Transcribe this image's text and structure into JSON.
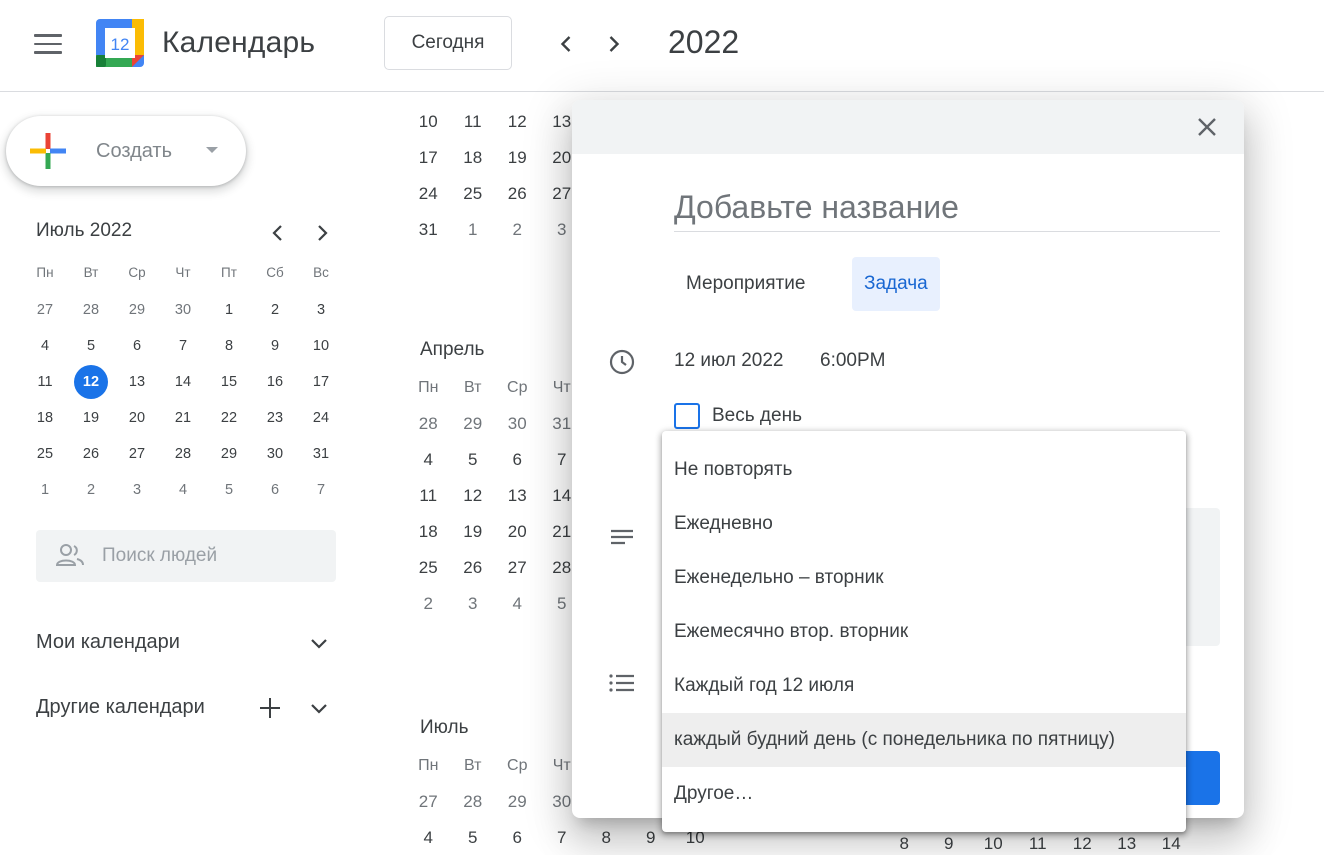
{
  "header": {
    "app_title": "Календарь",
    "logo_day": "12",
    "today_label": "Сегодня",
    "year_title": "2022"
  },
  "create": {
    "label": "Создать"
  },
  "mini_calendar": {
    "title": "Июль 2022",
    "weekdays": [
      "Пн",
      "Вт",
      "Ср",
      "Чт",
      "Пт",
      "Сб",
      "Вс"
    ],
    "weeks": [
      [
        "27",
        "28",
        "29",
        "30",
        "1",
        "2",
        "3"
      ],
      [
        "4",
        "5",
        "6",
        "7",
        "8",
        "9",
        "10"
      ],
      [
        "11",
        "12",
        "13",
        "14",
        "15",
        "16",
        "17"
      ],
      [
        "18",
        "19",
        "20",
        "21",
        "22",
        "23",
        "24"
      ],
      [
        "25",
        "26",
        "27",
        "28",
        "29",
        "30",
        "31"
      ],
      [
        "1",
        "2",
        "3",
        "4",
        "5",
        "6",
        "7"
      ]
    ],
    "today": "12"
  },
  "people_search": {
    "placeholder": "Поиск людей"
  },
  "sections": {
    "my_calendars": "Мои календари",
    "other_calendars": "Другие календари"
  },
  "background_year": {
    "top_rows": [
      [
        "10",
        "11",
        "12",
        "13"
      ],
      [
        "17",
        "18",
        "19",
        "20"
      ],
      [
        "24",
        "25",
        "26",
        "27"
      ],
      [
        "31",
        "1",
        "2",
        "3"
      ]
    ],
    "april": {
      "name": "Апрель",
      "weekdays": [
        "Пн",
        "Вт",
        "Ср",
        "Чт"
      ],
      "rows": [
        [
          "28",
          "29",
          "30",
          "31"
        ],
        [
          "4",
          "5",
          "6",
          "7"
        ],
        [
          "11",
          "12",
          "13",
          "14"
        ],
        [
          "18",
          "19",
          "20",
          "21"
        ],
        [
          "25",
          "26",
          "27",
          "28"
        ],
        [
          "2",
          "3",
          "4",
          "5"
        ]
      ]
    },
    "july": {
      "name": "Июль",
      "weekdays": [
        "Пн",
        "Вт",
        "Ср",
        "Чт"
      ],
      "rows": [
        [
          "27",
          "28",
          "29",
          "30"
        ],
        [
          "4",
          "5",
          "6",
          "7",
          "8",
          "9",
          "10"
        ]
      ]
    },
    "right_row": [
      "8",
      "9",
      "10",
      "11",
      "12",
      "13",
      "14"
    ]
  },
  "dialog": {
    "title_placeholder": "Добавьте название",
    "tabs": {
      "event": "Мероприятие",
      "task": "Задача"
    },
    "date": "12 июл 2022",
    "time": "6:00PM",
    "all_day_label": "Весь день"
  },
  "repeat_dropdown": {
    "options": [
      "Не повторять",
      "Ежедневно",
      "Еженедельно – вторник",
      "Ежемесячно втор. вторник",
      "Каждый год 12 июля",
      "каждый будний день (с понедельника по пятницу)",
      "Другое…"
    ],
    "highlighted_index": 5
  },
  "colors": {
    "accent": "#1a73e8",
    "task_tab_bg": "#e8f0fe",
    "task_tab_text": "#1967d2",
    "header_gray": "#f1f3f4"
  }
}
